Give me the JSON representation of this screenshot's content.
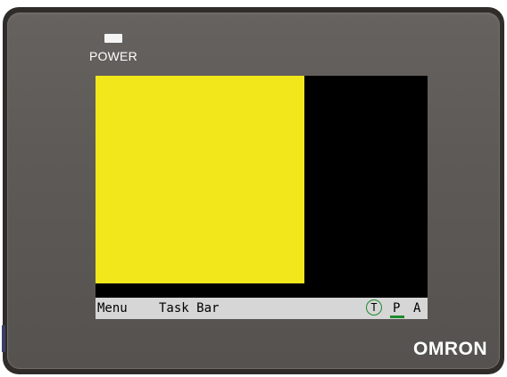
{
  "device": {
    "power_label": "POWER",
    "brand": "OMRON"
  },
  "screen": {
    "panel_color": "#f1e71a",
    "background_color": "#000000",
    "taskbar": {
      "menu_label": "Menu",
      "taskbar_label": "Task Bar",
      "indicators": {
        "t": "T",
        "p": "P",
        "a": "A"
      },
      "active_color": "#1c8a2d"
    }
  }
}
